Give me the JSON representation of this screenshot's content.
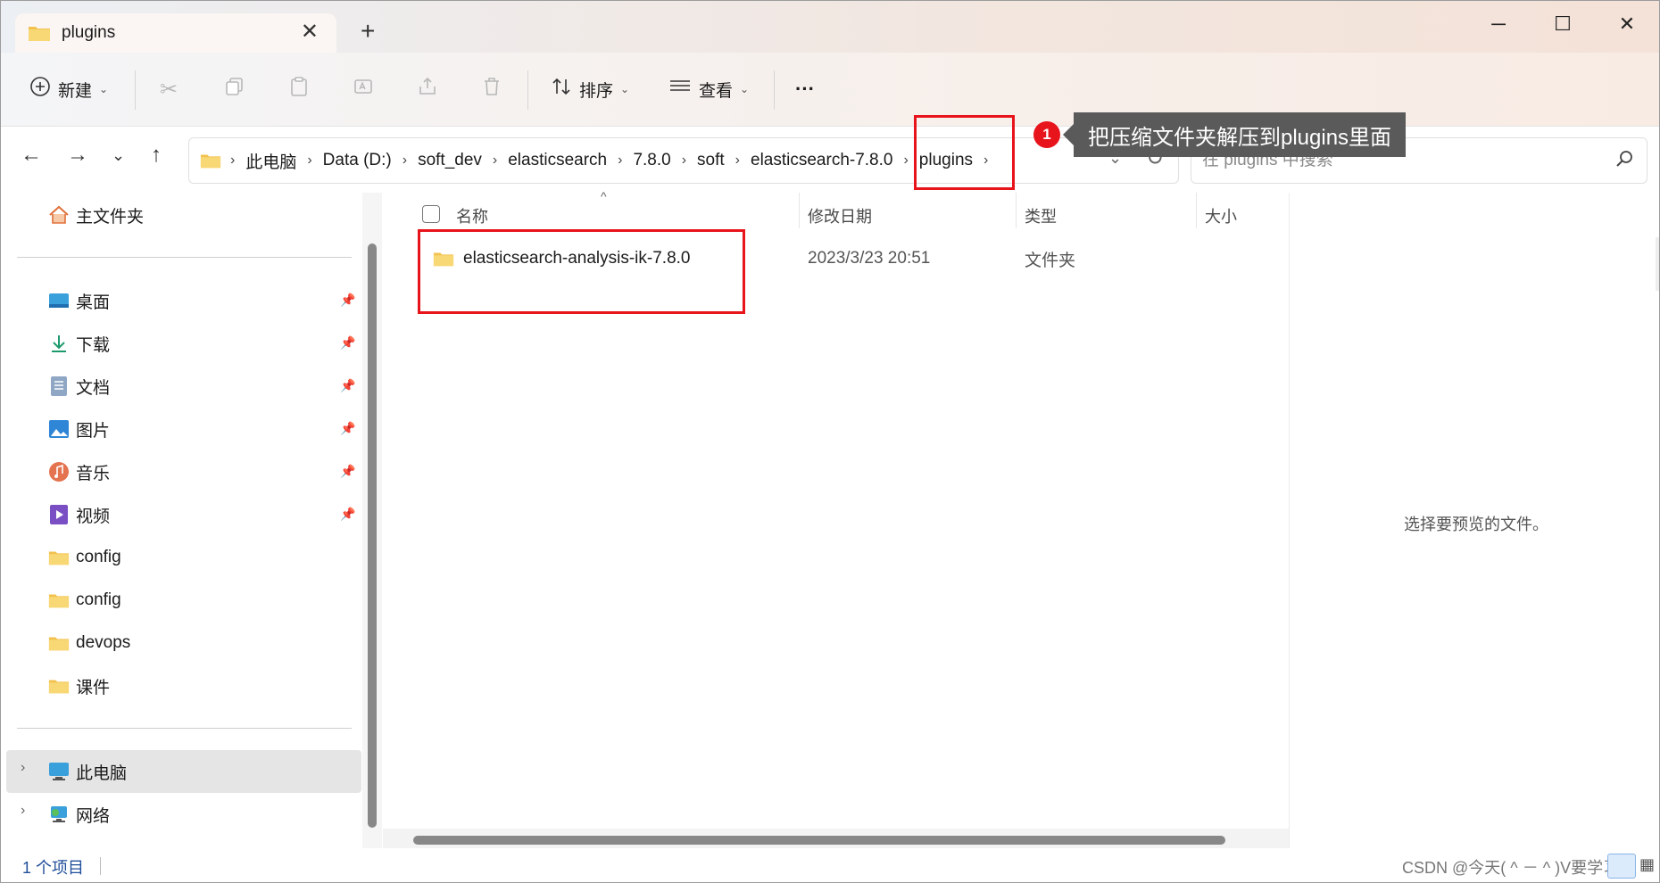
{
  "window": {
    "tab_title": "plugins",
    "tab_close": "✕",
    "new_tab": "+",
    "minimize": "─",
    "maximize": "☐",
    "close": "✕"
  },
  "toolbar": {
    "new_label": "新建",
    "sort_label": "排序",
    "view_label": "查看",
    "more_label": "···"
  },
  "address": {
    "crumbs": [
      "此电脑",
      "Data (D:)",
      "soft_dev",
      "elasticsearch",
      "7.8.0",
      "soft",
      "elasticsearch-7.8.0",
      "plugins"
    ],
    "search_placeholder": "在 plugins 中搜索"
  },
  "sidebar": {
    "home": "主文件夹",
    "pinned": [
      {
        "label": "桌面",
        "icon": "desktop-icon"
      },
      {
        "label": "下载",
        "icon": "download-icon"
      },
      {
        "label": "文档",
        "icon": "document-icon"
      },
      {
        "label": "图片",
        "icon": "pictures-icon"
      },
      {
        "label": "音乐",
        "icon": "music-icon"
      },
      {
        "label": "视频",
        "icon": "video-icon"
      }
    ],
    "folders": [
      "config",
      "config",
      "devops",
      "课件"
    ],
    "this_pc": "此电脑",
    "network": "网络"
  },
  "columns": {
    "name": "名称",
    "date": "修改日期",
    "type": "类型",
    "size": "大小"
  },
  "files": [
    {
      "name": "elasticsearch-analysis-ik-7.8.0",
      "date": "2023/3/23 20:51",
      "type": "文件夹"
    }
  ],
  "preview": {
    "message": "选择要预览的文件。"
  },
  "status": {
    "count": "1 个项目",
    "watermark": "CSDN @今天( ^ － ^ )V要学习吗"
  },
  "annotation": {
    "number": "1",
    "text": "把压缩文件夹解压到plugins里面",
    "color": "#e8141c"
  }
}
